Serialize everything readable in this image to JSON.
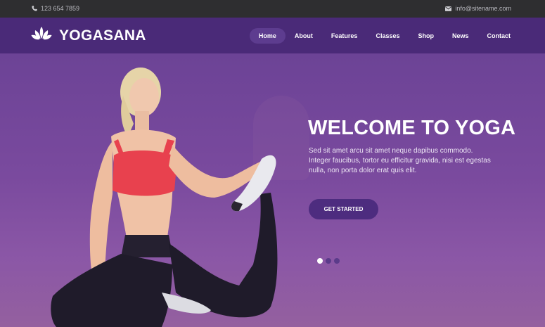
{
  "topbar": {
    "phone": "123 654 7859",
    "email": "info@sitename.com",
    "phone_icon": "phone-icon",
    "email_icon": "envelope-icon"
  },
  "brand": {
    "name": "YOGASANA",
    "logo_icon": "lotus-icon"
  },
  "nav": {
    "items": [
      {
        "label": "Home",
        "active": true
      },
      {
        "label": "About"
      },
      {
        "label": "Features"
      },
      {
        "label": "Classes"
      },
      {
        "label": "Shop"
      },
      {
        "label": "News"
      },
      {
        "label": "Contact"
      }
    ]
  },
  "hero": {
    "headline": "WELCOME TO YOGA",
    "subtext": "Sed sit amet arcu sit amet neque dapibus commodo. Integer faucibus, tortor eu efficitur gravida, nisi est egestas nulla, non porta dolor erat quis elit.",
    "cta_label": "GET STARTED",
    "slides": 3,
    "active_slide": 1
  },
  "colors": {
    "topbar": "#2e2e30",
    "navbar": "#4a2a78",
    "accent": "#4d2c7f",
    "hero_top": "#6c4396",
    "hero_bottom": "#94609f"
  }
}
